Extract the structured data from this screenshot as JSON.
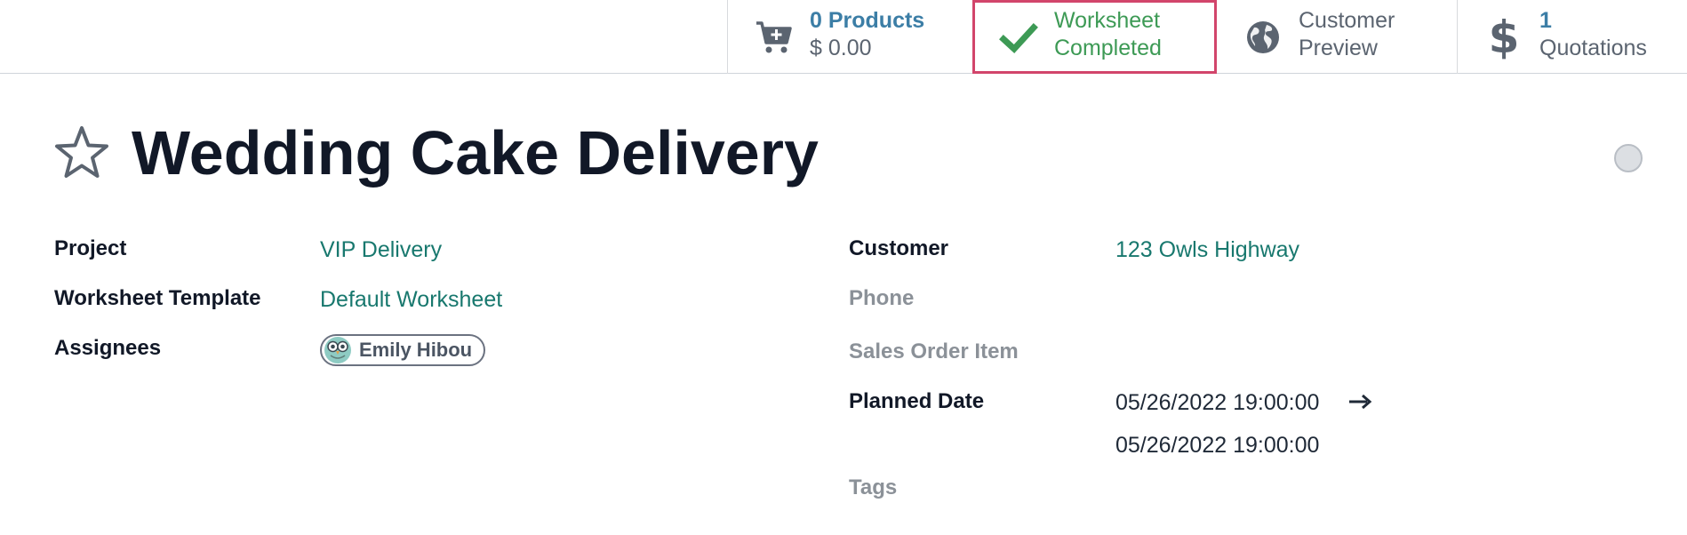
{
  "stat_buttons": {
    "products": {
      "icon": "cart-plus-icon",
      "value": "0 Products",
      "sub": "$ 0.00"
    },
    "worksheet": {
      "icon": "checkmark-icon",
      "line1": "Worksheet",
      "line2": "Completed"
    },
    "preview": {
      "icon": "globe-icon",
      "line1": "Customer",
      "line2": "Preview"
    },
    "quotations": {
      "icon": "dollar-icon",
      "count": "1",
      "label": "Quotations"
    }
  },
  "record": {
    "title": "Wedding Cake Delivery"
  },
  "fields_left": {
    "project_label": "Project",
    "project_value": "VIP Delivery",
    "template_label": "Worksheet Template",
    "template_value": "Default Worksheet",
    "assignees_label": "Assignees",
    "assignee_name": "Emily Hibou"
  },
  "fields_right": {
    "customer_label": "Customer",
    "customer_value": "123 Owls Highway",
    "phone_label": "Phone",
    "sales_order_label": "Sales Order Item",
    "planned_label": "Planned Date",
    "planned_start": "05/26/2022 19:00:00",
    "planned_end": "05/26/2022 19:00:00",
    "tags_label": "Tags"
  },
  "colors": {
    "link": "#18786e",
    "stat_blue": "#3c7ea6",
    "success": "#3d9a55",
    "highlight_border": "#d2456b"
  }
}
